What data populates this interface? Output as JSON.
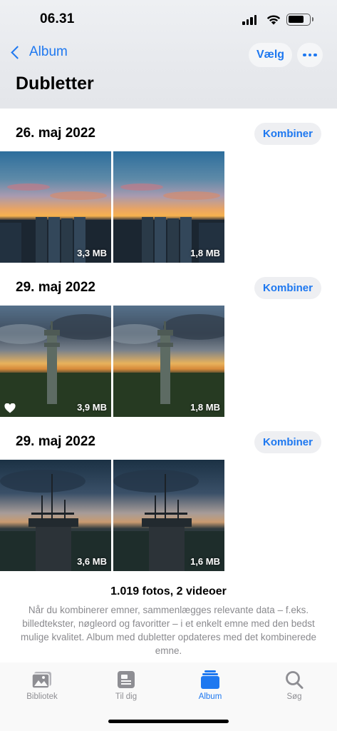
{
  "status_bar": {
    "time": "06.31"
  },
  "nav": {
    "back_label": "Album",
    "select_label": "Vælg",
    "title": "Dubletter"
  },
  "groups": [
    {
      "date": "26. maj 2022",
      "combine_label": "Kombiner",
      "photos": [
        {
          "size": "3,3 MB",
          "favorite": false
        },
        {
          "size": "1,8 MB",
          "favorite": false
        }
      ]
    },
    {
      "date": "29. maj 2022",
      "combine_label": "Kombiner",
      "photos": [
        {
          "size": "3,9 MB",
          "favorite": true
        },
        {
          "size": "1,8 MB",
          "favorite": false
        }
      ]
    },
    {
      "date": "29. maj 2022",
      "combine_label": "Kombiner",
      "photos": [
        {
          "size": "3,6 MB",
          "favorite": false
        },
        {
          "size": "1,6 MB",
          "favorite": false
        }
      ]
    }
  ],
  "footer": {
    "counts": "1.019 fotos, 2 videoer",
    "info": "Når du kombinerer emner, sammenlægges relevante data – f.eks. billedtekster, nøgleord og favoritter – i et enkelt emne med den bedst mulige kvalitet. Album med dubletter opdateres med det kombinerede emne."
  },
  "tabs": [
    {
      "label": "Bibliotek",
      "icon": "photo-library-icon",
      "active": false
    },
    {
      "label": "Til dig",
      "icon": "for-you-icon",
      "active": false
    },
    {
      "label": "Album",
      "icon": "album-stack-icon",
      "active": true
    },
    {
      "label": "Søg",
      "icon": "search-icon",
      "active": false
    }
  ],
  "colors": {
    "accent": "#1e78f0",
    "inactive_tab": "#8e8e93",
    "secondary_text": "#8a8a8e"
  }
}
